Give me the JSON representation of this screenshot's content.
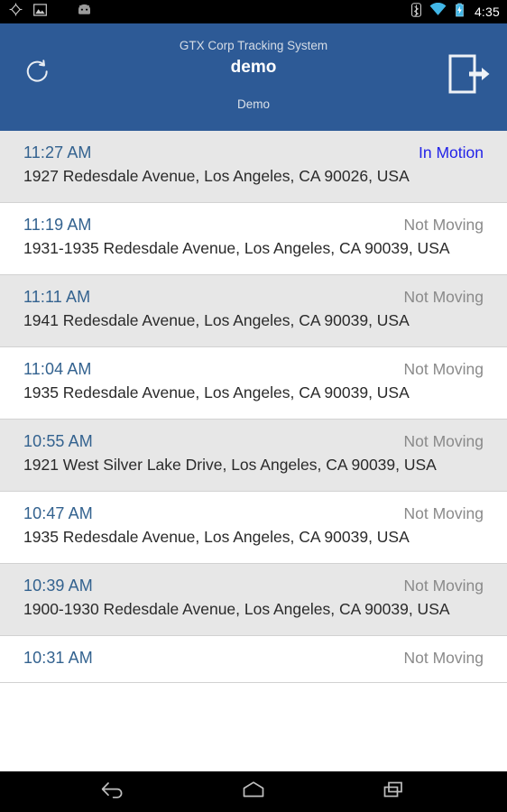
{
  "statusbar": {
    "icons_left": [
      "gps-icon",
      "screenshot-icon",
      "android-debug-icon"
    ],
    "icons_right": [
      "bluetooth-icon",
      "wifi-icon",
      "battery-charging-icon"
    ],
    "time": "4:35"
  },
  "header": {
    "refresh_label": "refresh-icon",
    "logout_label": "logout-icon",
    "subtitle": "GTX Corp Tracking System",
    "title": "demo",
    "account": "Demo",
    "background_color": "#2d5a96"
  },
  "colors": {
    "header_blue": "#2d5a96",
    "time_blue": "#33628f",
    "in_motion_blue": "#2323e8",
    "not_moving_gray": "#8a8a8a",
    "row_alt_bg": "#e7e7e7",
    "row_bg": "#ffffff"
  },
  "list": {
    "rows": [
      {
        "time": "11:27 AM",
        "status": "In Motion",
        "status_type": "moving",
        "address": "1927 Redesdale Avenue, Los Angeles, CA 90026, USA"
      },
      {
        "time": "11:19 AM",
        "status": "Not Moving",
        "status_type": "idle",
        "address": "1931-1935 Redesdale Avenue, Los Angeles, CA 90039, USA"
      },
      {
        "time": "11:11 AM",
        "status": "Not Moving",
        "status_type": "idle",
        "address": "1941 Redesdale Avenue, Los Angeles, CA 90039, USA"
      },
      {
        "time": "11:04 AM",
        "status": "Not Moving",
        "status_type": "idle",
        "address": "1935 Redesdale Avenue, Los Angeles, CA 90039, USA"
      },
      {
        "time": "10:55 AM",
        "status": "Not Moving",
        "status_type": "idle",
        "address": "1921 West Silver Lake Drive, Los Angeles, CA 90039, USA"
      },
      {
        "time": "10:47 AM",
        "status": "Not Moving",
        "status_type": "idle",
        "address": "1935 Redesdale Avenue, Los Angeles, CA 90039, USA"
      },
      {
        "time": "10:39 AM",
        "status": "Not Moving",
        "status_type": "idle",
        "address": "1900-1930 Redesdale Avenue, Los Angeles, CA 90039, USA"
      },
      {
        "time": "10:31 AM",
        "status": "Not Moving",
        "status_type": "idle",
        "address": ""
      }
    ]
  },
  "navbar": {
    "back_label": "back-icon",
    "home_label": "home-icon",
    "recents_label": "recent-apps-icon"
  }
}
